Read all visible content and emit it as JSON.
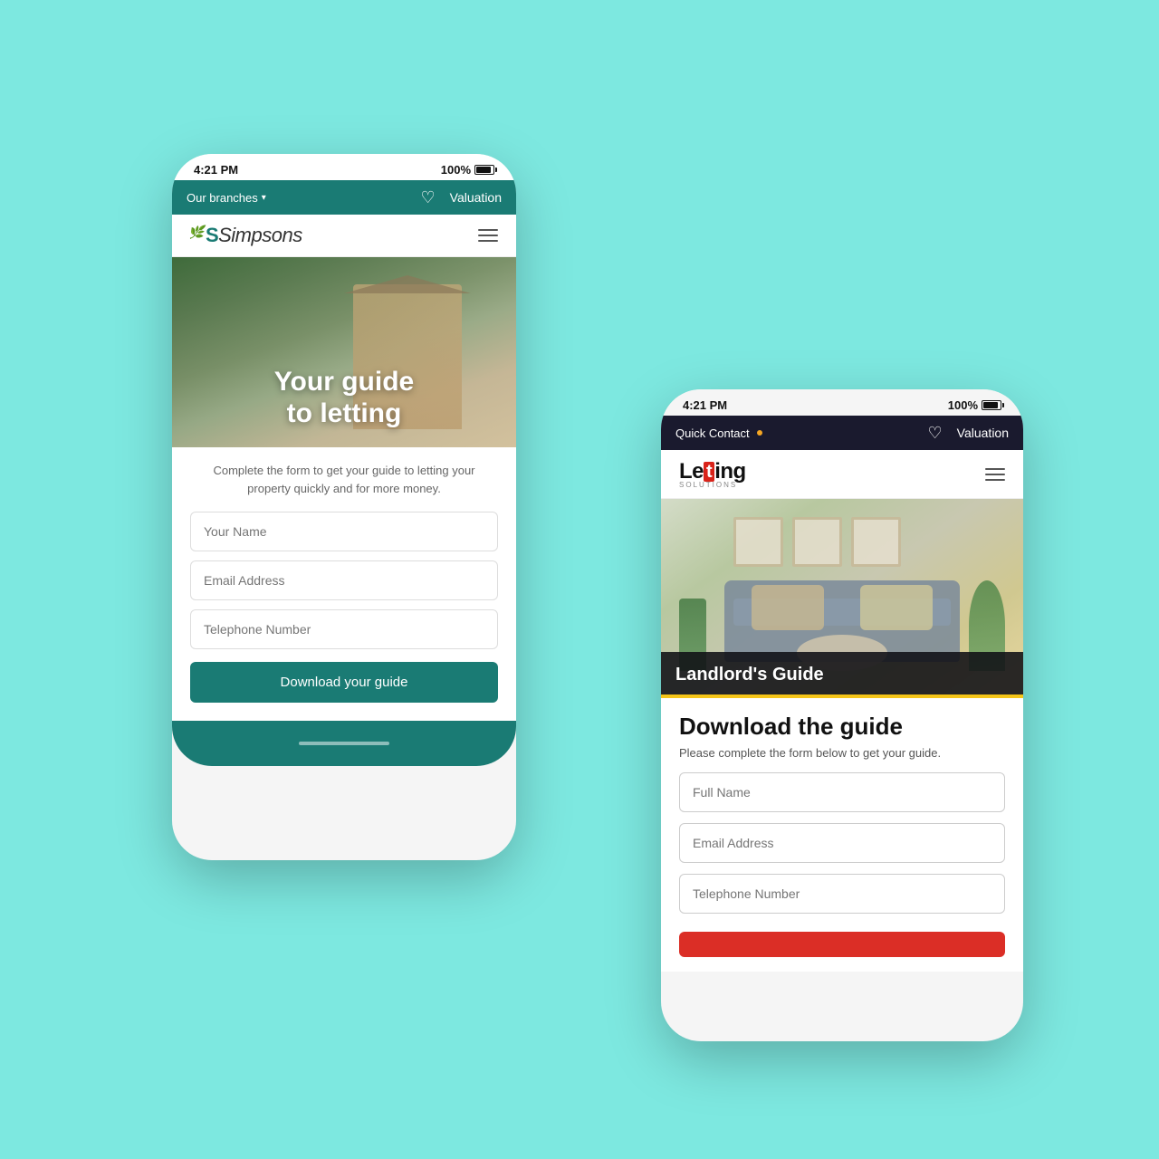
{
  "background": "#7de8e0",
  "phone1": {
    "time": "4:21 PM",
    "battery": "100%",
    "nav": {
      "branches": "Our branches",
      "branches_arrow": "↓",
      "valuation": "Valuation"
    },
    "logo": "Simpsons",
    "hero_title_line1": "Your guide",
    "hero_title_line2": "to letting",
    "description": "Complete the form to get your guide to letting your property quickly and for more money.",
    "form": {
      "name_placeholder": "Your Name",
      "email_placeholder": "Email Address",
      "phone_placeholder": "Telephone Number",
      "button_label": "Download your guide"
    }
  },
  "phone2": {
    "time": "4:21 PM",
    "battery": "100%",
    "nav": {
      "contact": "Quick Contact",
      "contact_dot": "·",
      "valuation": "Valuation"
    },
    "logo": "Letting",
    "logo_sub": "SOLUTIONS",
    "hero_label": "Landlord's Guide",
    "section_title": "Download the guide",
    "description": "Please complete the form below to get your guide.",
    "form": {
      "name_placeholder": "Full Name",
      "email_placeholder": "Email Address",
      "phone_placeholder": "Telephone Number"
    }
  }
}
